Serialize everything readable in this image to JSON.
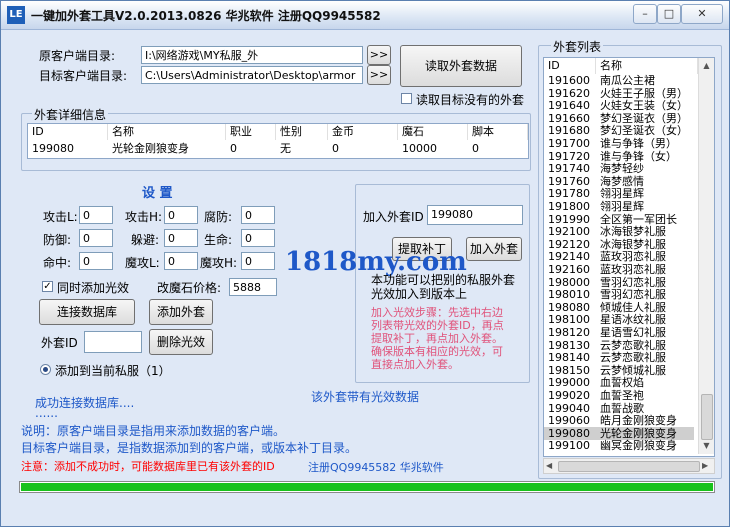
{
  "titlebar": {
    "icon": "LE",
    "title": "一键加外套工具V2.0.2013.0826 华兆软件 注册QQ9945582",
    "min": "–",
    "restore": "□",
    "close": "✕"
  },
  "paths": {
    "source_label": "原客户端目录:",
    "source_value": "I:\\网络游戏\\MY私服_外",
    "target_label": "目标客户端目录:",
    "target_value": "C:\\Users\\Administrator\\Desktop\\armor",
    "browse": ">>"
  },
  "read_button": "读取外套数据",
  "read_missing_label": "读取目标没有的外套",
  "detail": {
    "title": "外套详细信息",
    "headers": [
      "ID",
      "名称",
      "职业",
      "性别",
      "金币",
      "魔石",
      "脚本"
    ],
    "row": [
      "199080",
      "光轮金刚狼变身",
      "0",
      "无",
      "0",
      "10000",
      "0"
    ]
  },
  "settings": {
    "title": "设 置",
    "fields": [
      {
        "label": "攻击L:",
        "value": "0"
      },
      {
        "label": "攻击H:",
        "value": "0"
      },
      {
        "label": "腐防:",
        "value": "0"
      },
      {
        "label": "防御:",
        "value": "0"
      },
      {
        "label": "躲避:",
        "value": "0"
      },
      {
        "label": "生命:",
        "value": "0"
      },
      {
        "label": "命中:",
        "value": "0"
      },
      {
        "label": "魔攻L:",
        "value": "0"
      },
      {
        "label": "魔攻H:",
        "value": "0"
      }
    ],
    "sync_effect": "同时添加光效",
    "price_label": "改魔石价格:",
    "price_value": "5888",
    "connect_db": "连接数据库",
    "add_coat": "添加外套",
    "coat_id_label": "外套ID",
    "coat_id_value": "",
    "delete_effect": "删除光效",
    "add_to_server": "添加到当前私服（1）"
  },
  "patch": {
    "add_id_label": "加入外套ID",
    "add_id_value": "199080",
    "extract_btn": "提取补丁",
    "add_btn": "加入外套",
    "watermark": "1818my.com",
    "desc1": "本功能可以把别的私服外套",
    "desc2": "光效加入到版本上",
    "steps": [
      "加入光效步骤：先选中右边",
      "列表带光效的外套ID，再点",
      "提取补丁，再点加入外套。",
      "确保版本有相应的光效，可",
      "直接点加入外套。"
    ]
  },
  "status": {
    "connected": "成功连接数据库....",
    "dots": "......",
    "has_effect": "该外套带有光效数据",
    "note1": "说明：原客户端目录是指用来添加数据的客户端。",
    "note2": "目标客户端目录，是指数据添加到的客户端，或版本补丁目录。",
    "warning": "注意：添加不成功时，可能数据库里已有该外套的ID",
    "register": "注册QQ9945582 华兆软件",
    "progress": 1.0
  },
  "colors": {
    "blue_text": "#1e58c8",
    "red_text": "#ff0000",
    "pink_text": "#e0527a",
    "progress": "#18c21c",
    "selected": "#cfcfcf"
  },
  "coat_list": {
    "title": "外套列表",
    "headers": [
      "ID",
      "名称"
    ],
    "rows": [
      [
        "191600",
        "南瓜公主裙"
      ],
      [
        "191620",
        "火娃王子服（男）"
      ],
      [
        "191640",
        "火娃女王装（女）"
      ],
      [
        "191660",
        "梦幻圣诞衣（男）"
      ],
      [
        "191680",
        "梦幻圣诞衣（女）"
      ],
      [
        "191700",
        "谁与争锋（男）"
      ],
      [
        "191720",
        "谁与争锋（女）"
      ],
      [
        "191740",
        "海梦轻纱"
      ],
      [
        "191760",
        "海梦感情"
      ],
      [
        "191780",
        "翎羽星辉"
      ],
      [
        "191800",
        "翎羽星辉"
      ],
      [
        "191990",
        "全区第一军团长"
      ],
      [
        "192100",
        "冰海银梦礼服"
      ],
      [
        "192120",
        "冰海银梦礼服"
      ],
      [
        "192140",
        "蓝玫羽恋礼服"
      ],
      [
        "192160",
        "蓝玫羽恋礼服"
      ],
      [
        "198000",
        "雪羽幻恋礼服"
      ],
      [
        "198010",
        "雪羽幻恋礼服"
      ],
      [
        "198080",
        "倾城佳人礼服"
      ],
      [
        "198100",
        "星语冰纹礼服"
      ],
      [
        "198120",
        "星语雪幻礼服"
      ],
      [
        "198130",
        "云梦恋歌礼服"
      ],
      [
        "198140",
        "云梦恋歌礼服"
      ],
      [
        "198150",
        "云梦倾城礼服"
      ],
      [
        "199000",
        "血誓权焰"
      ],
      [
        "199020",
        "血誓圣袍"
      ],
      [
        "199040",
        "血誓战歌"
      ],
      [
        "199060",
        "皓月金刚狼变身"
      ],
      [
        "199080",
        "光轮金刚狼变身"
      ],
      [
        "199100",
        "幽冥金刚狼变身"
      ]
    ],
    "selected_index": 28
  }
}
